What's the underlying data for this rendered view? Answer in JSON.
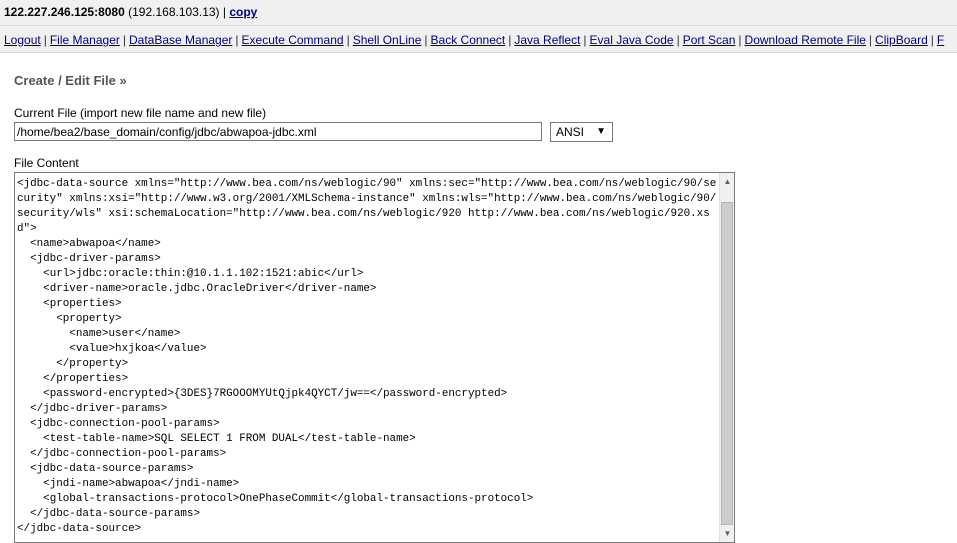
{
  "header": {
    "host": "122.227.246.125:8080",
    "local_ip": "(192.168.103.13)",
    "separator": " | ",
    "copy_label": "copy"
  },
  "nav": {
    "items": [
      {
        "label": "Logout"
      },
      {
        "label": "File Manager"
      },
      {
        "label": "DataBase Manager"
      },
      {
        "label": "Execute Command"
      },
      {
        "label": "Shell OnLine"
      },
      {
        "label": "Back Connect"
      },
      {
        "label": "Java Reflect"
      },
      {
        "label": "Eval Java Code"
      },
      {
        "label": "Port Scan"
      },
      {
        "label": "Download Remote File"
      },
      {
        "label": "ClipBoard"
      },
      {
        "label": "F"
      }
    ],
    "separator": "|"
  },
  "editor": {
    "title": "Create / Edit File »",
    "current_file_label": "Current File (import new file name and new file)",
    "current_file_value": "/home/bea2/base_domain/config/jdbc/abwapoa-jdbc.xml",
    "encoding_selected": "ANSI",
    "file_content_label": "File Content",
    "file_content": "<jdbc-data-source xmlns=\"http://www.bea.com/ns/weblogic/90\" xmlns:sec=\"http://www.bea.com/ns/weblogic/90/security\" xmlns:xsi=\"http://www.w3.org/2001/XMLSchema-instance\" xmlns:wls=\"http://www.bea.com/ns/weblogic/90/security/wls\" xsi:schemaLocation=\"http://www.bea.com/ns/weblogic/920 http://www.bea.com/ns/weblogic/920.xsd\">\n  <name>abwapoa</name>\n  <jdbc-driver-params>\n    <url>jdbc:oracle:thin:@10.1.1.102:1521:abic</url>\n    <driver-name>oracle.jdbc.OracleDriver</driver-name>\n    <properties>\n      <property>\n        <name>user</name>\n        <value>hxjkoa</value>\n      </property>\n    </properties>\n    <password-encrypted>{3DES}7RGOOOMYUtQjpk4QYCT/jw==</password-encrypted>\n  </jdbc-driver-params>\n  <jdbc-connection-pool-params>\n    <test-table-name>SQL SELECT 1 FROM DUAL</test-table-name>\n  </jdbc-connection-pool-params>\n  <jdbc-data-source-params>\n    <jndi-name>abwapoa</jndi-name>\n    <global-transactions-protocol>OnePhaseCommit</global-transactions-protocol>\n  </jdbc-data-source-params>\n</jdbc-data-source>"
  },
  "icons": {
    "select_arrow": "▼",
    "scroll_up": "▲",
    "scroll_down": "▼"
  }
}
